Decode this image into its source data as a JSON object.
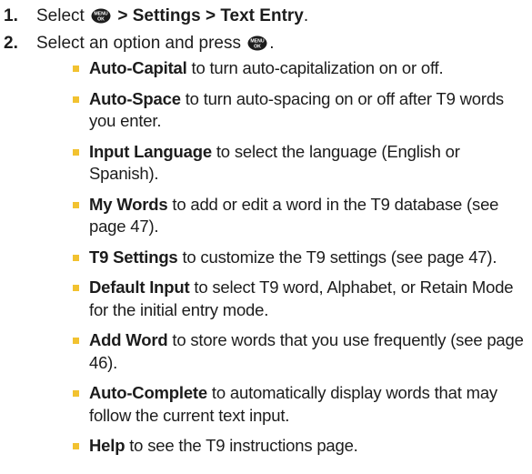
{
  "steps": [
    {
      "number": "1.",
      "pre": "Select",
      "key_icon": "menu-ok-key-icon",
      "path": "> Settings > Text Entry",
      "post": "."
    },
    {
      "number": "2.",
      "pre": "Select an option and press",
      "key_icon": "menu-ok-key-icon",
      "post": "."
    }
  ],
  "options": [
    {
      "term": "Auto-Capital",
      "desc": " to turn auto-capitalization on or off."
    },
    {
      "term": "Auto-Space",
      "desc": " to turn auto-spacing on or off after T9 words you enter."
    },
    {
      "term": "Input Language",
      "desc": " to select the language (English or Spanish)."
    },
    {
      "term": "My Words",
      "desc": " to add or edit a word in the T9 database (see page 47)."
    },
    {
      "term": "T9 Settings",
      "desc": " to customize the T9 settings (see page 47)."
    },
    {
      "term": "Default Input",
      "desc": " to select T9 word, Alphabet, or Retain Mode for the initial entry mode."
    },
    {
      "term": "Add Word",
      "desc": " to store words that you use frequently (see page 46)."
    },
    {
      "term": "Auto-Complete",
      "desc": " to automatically display words that may follow the current text input."
    },
    {
      "term": "Help",
      "desc": " to see the T9 instructions page."
    }
  ],
  "key_icon_text": {
    "top": "MENU",
    "bottom": "OK"
  },
  "colors": {
    "bullet": "#f2c230",
    "step_number": "#1c1c1c",
    "text": "#1c1c1c",
    "key_icon": "#1c1c1c"
  }
}
